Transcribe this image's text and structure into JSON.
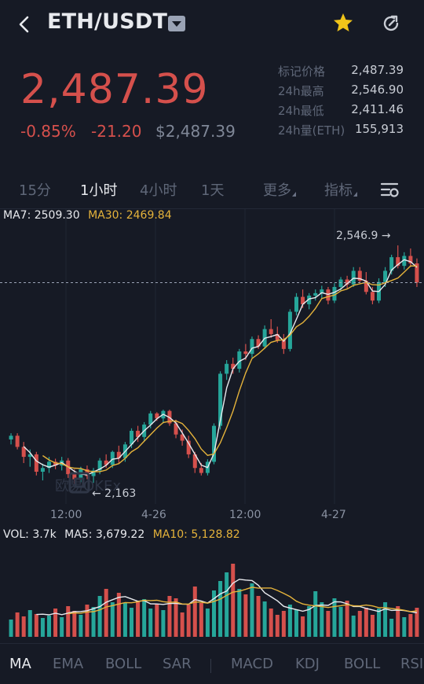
{
  "header": {
    "title": "ETH/USDT",
    "icons": [
      "back-icon",
      "dropdown-icon",
      "star-icon",
      "refresh-icon"
    ],
    "star_color": "#f0c419"
  },
  "ticker": {
    "price": "2,487.39",
    "change_pct": "-0.85%",
    "change_abs": "-21.20",
    "price_usd": "$2,487.39",
    "color_down": "#d5504c",
    "color_up": "#26a69a"
  },
  "stats": [
    {
      "label": "标记价格",
      "value": "2,487.39"
    },
    {
      "label": "24h最高",
      "value": "2,546.90"
    },
    {
      "label": "24h最低",
      "value": "2,411.46"
    },
    {
      "label": "24h量(ETH)",
      "value": "155,913"
    }
  ],
  "intervals": {
    "items": [
      "15分",
      "1小时",
      "4小时",
      "1天"
    ],
    "active": "1小时",
    "more": "更多",
    "indicators": "指标"
  },
  "chart_legend": {
    "ma7": "MA7: 2509.30",
    "ma30": "MA30: 2469.84",
    "high_label": "2,546.9 →",
    "low_label": "← 2,163",
    "watermark": "欧易OKEx"
  },
  "time_labels": [
    "12:00",
    "4-26",
    "12:00",
    "4-27"
  ],
  "volume_legend": {
    "vol": "VOL: 3.7k",
    "ma5": "MA5: 3,679.22",
    "ma10": "MA10: 5,128.82"
  },
  "indicator_tabs": {
    "main": [
      "MA",
      "EMA",
      "BOLL",
      "SAR"
    ],
    "sub": [
      "MACD",
      "KDJ",
      "BOLL",
      "RSI"
    ],
    "active": "MA"
  },
  "chart_data": {
    "type": "candlestick",
    "ohlc": [
      [
        2234,
        2244,
        2226,
        2240
      ],
      [
        2240,
        2244,
        2218,
        2222
      ],
      [
        2222,
        2230,
        2196,
        2206
      ],
      [
        2206,
        2218,
        2190,
        2210
      ],
      [
        2210,
        2214,
        2176,
        2182
      ],
      [
        2182,
        2195,
        2168,
        2188
      ],
      [
        2188,
        2206,
        2180,
        2198
      ],
      [
        2198,
        2203,
        2186,
        2192
      ],
      [
        2192,
        2206,
        2184,
        2200
      ],
      [
        2200,
        2204,
        2172,
        2178
      ],
      [
        2178,
        2186,
        2163,
        2170
      ],
      [
        2170,
        2190,
        2165,
        2186
      ],
      [
        2186,
        2192,
        2170,
        2175
      ],
      [
        2175,
        2188,
        2164,
        2184
      ],
      [
        2184,
        2204,
        2178,
        2200
      ],
      [
        2200,
        2210,
        2188,
        2193
      ],
      [
        2193,
        2216,
        2188,
        2214
      ],
      [
        2214,
        2224,
        2196,
        2204
      ],
      [
        2204,
        2230,
        2198,
        2226
      ],
      [
        2226,
        2252,
        2220,
        2248
      ],
      [
        2248,
        2256,
        2230,
        2238
      ],
      [
        2238,
        2262,
        2232,
        2258
      ],
      [
        2258,
        2280,
        2252,
        2276
      ],
      [
        2276,
        2278,
        2264,
        2268
      ],
      [
        2268,
        2282,
        2260,
        2280
      ],
      [
        2280,
        2282,
        2256,
        2260
      ],
      [
        2260,
        2266,
        2236,
        2242
      ],
      [
        2242,
        2250,
        2224,
        2232
      ],
      [
        2232,
        2240,
        2204,
        2210
      ],
      [
        2210,
        2214,
        2180,
        2188
      ],
      [
        2188,
        2196,
        2176,
        2180
      ],
      [
        2180,
        2202,
        2176,
        2198
      ],
      [
        2198,
        2260,
        2194,
        2256
      ],
      [
        2256,
        2344,
        2250,
        2340
      ],
      [
        2340,
        2362,
        2330,
        2356
      ],
      [
        2356,
        2366,
        2340,
        2348
      ],
      [
        2348,
        2380,
        2342,
        2376
      ],
      [
        2376,
        2388,
        2362,
        2372
      ],
      [
        2372,
        2400,
        2366,
        2396
      ],
      [
        2396,
        2402,
        2380,
        2384
      ],
      [
        2384,
        2418,
        2380,
        2412
      ],
      [
        2412,
        2428,
        2398,
        2404
      ],
      [
        2404,
        2416,
        2390,
        2394
      ],
      [
        2394,
        2404,
        2372,
        2380
      ],
      [
        2380,
        2444,
        2376,
        2440
      ],
      [
        2440,
        2470,
        2434,
        2464
      ],
      [
        2464,
        2476,
        2446,
        2452
      ],
      [
        2452,
        2470,
        2444,
        2466
      ],
      [
        2466,
        2476,
        2458,
        2470
      ],
      [
        2470,
        2482,
        2462,
        2476
      ],
      [
        2476,
        2480,
        2452,
        2458
      ],
      [
        2458,
        2486,
        2454,
        2480
      ],
      [
        2480,
        2496,
        2474,
        2492
      ],
      [
        2492,
        2498,
        2478,
        2484
      ],
      [
        2484,
        2512,
        2480,
        2506
      ],
      [
        2506,
        2512,
        2486,
        2490
      ],
      [
        2490,
        2504,
        2468,
        2472
      ],
      [
        2472,
        2480,
        2452,
        2458
      ],
      [
        2458,
        2494,
        2454,
        2488
      ],
      [
        2488,
        2512,
        2480,
        2506
      ],
      [
        2506,
        2532,
        2500,
        2528
      ],
      [
        2528,
        2547,
        2510,
        2514
      ],
      [
        2514,
        2536,
        2508,
        2530
      ],
      [
        2530,
        2542,
        2512,
        2518
      ],
      [
        2518,
        2526,
        2480,
        2487
      ]
    ],
    "ylim": [
      2130,
      2570
    ],
    "high": 2546.9,
    "low": 2163,
    "ma_series": [
      {
        "name": "MA7",
        "color": "#e8eaee"
      },
      {
        "name": "MA30",
        "color": "#e5b33b"
      }
    ],
    "volume": [
      2200,
      3100,
      2600,
      3400,
      2900,
      2400,
      2700,
      3600,
      2500,
      3900,
      3300,
      2800,
      4100,
      3800,
      5200,
      6100,
      4400,
      5600,
      4300,
      3700,
      4600,
      4800,
      3600,
      4200,
      3400,
      5200,
      4900,
      3100,
      4100,
      6400,
      4300,
      3600,
      5900,
      7100,
      8200,
      9300,
      6100,
      5400,
      6800,
      5200,
      4500,
      3600,
      2800,
      3300,
      4100,
      3500,
      2600,
      3900,
      5800,
      4400,
      3300,
      4900,
      3800,
      4600,
      2700,
      3300,
      3700,
      2800,
      3600,
      4400,
      2300,
      3900,
      2500,
      2900,
      3700
    ],
    "vol_ylim": [
      0,
      12000
    ],
    "vol_ma_series": [
      {
        "name": "MA5",
        "color": "#e8eaee"
      },
      {
        "name": "MA10",
        "color": "#e5b33b"
      }
    ]
  }
}
